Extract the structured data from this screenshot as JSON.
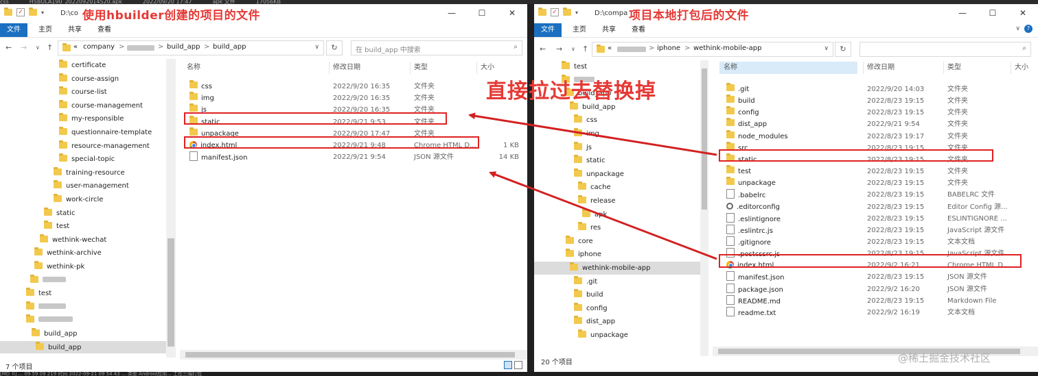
{
  "background": {
    "top_strip": [
      "css",
      "H5BULA190_2022092014520.apk",
      "2022/09/20 17:47",
      "apk 文件",
      "17056KB"
    ],
    "bottom_strip": "[MD_ll] ... 09 59 09 219  时间  2022-09-21 09 54 43  ...  类型  Android应用...  工在三端打包"
  },
  "left": {
    "title_path": "D:\\co",
    "title_note": "使用hbuilder创建的项目的文件",
    "window_buttons": [
      "—",
      "☐",
      "✕"
    ],
    "ribbon": [
      "文件",
      "主页",
      "共享",
      "查看"
    ],
    "address": [
      "«",
      "company",
      ">",
      "build_app",
      ">",
      "build_app"
    ],
    "search_placeholder": "在 build_app 中搜索",
    "tree": [
      {
        "label": "certificate"
      },
      {
        "label": "course-assign"
      },
      {
        "label": "course-list"
      },
      {
        "label": "course-management"
      },
      {
        "label": "my-responsible"
      },
      {
        "label": "questionnaire-template"
      },
      {
        "label": "resource-management"
      },
      {
        "label": "special-topic"
      },
      {
        "label": "training-resource"
      },
      {
        "label": "user-management"
      },
      {
        "label": "work-circle"
      },
      {
        "label": "static"
      },
      {
        "label": "test"
      },
      {
        "label": "wethink-wechat"
      },
      {
        "label": "wethink-archive"
      },
      {
        "label": "wethink-pk"
      },
      {
        "label": ""
      },
      {
        "label": "test"
      },
      {
        "label": ""
      },
      {
        "label": ""
      },
      {
        "label": "build_app"
      },
      {
        "label": "build_app"
      }
    ],
    "columns": [
      "名称",
      "修改日期",
      "类型",
      "大小"
    ],
    "files": [
      {
        "name": "css",
        "date": "2022/9/20 16:35",
        "type": "文件夹",
        "size": "",
        "icon": "folder"
      },
      {
        "name": "img",
        "date": "2022/9/20 16:35",
        "type": "文件夹",
        "size": "",
        "icon": "folder"
      },
      {
        "name": "js",
        "date": "2022/9/20 16:35",
        "type": "文件夹",
        "size": "",
        "icon": "folder"
      },
      {
        "name": "static",
        "date": "2022/9/21 9:53",
        "type": "文件夹",
        "size": "",
        "icon": "folder"
      },
      {
        "name": "unpackage",
        "date": "2022/9/20 17:47",
        "type": "文件夹",
        "size": "",
        "icon": "folder"
      },
      {
        "name": "index.html",
        "date": "2022/9/21 9:48",
        "type": "Chrome HTML D...",
        "size": "1 KB",
        "icon": "chrome"
      },
      {
        "name": "manifest.json",
        "date": "2022/9/21 9:54",
        "type": "JSON 源文件",
        "size": "14 KB",
        "icon": "file"
      }
    ],
    "status": "7 个项目"
  },
  "right": {
    "title_path": "D:\\compa",
    "title_note": "项目本地打包后的文件",
    "window_buttons": [
      "—",
      "☐",
      "✕"
    ],
    "ribbon": [
      "文件",
      "主页",
      "共享",
      "查看"
    ],
    "address": [
      "«",
      "iphone",
      ">",
      "wethink-mobile-app"
    ],
    "tree": [
      {
        "label": "test"
      },
      {
        "label": ""
      },
      {
        "label": "build_app"
      },
      {
        "label": "build_app"
      },
      {
        "label": "css"
      },
      {
        "label": "img"
      },
      {
        "label": "js"
      },
      {
        "label": "static"
      },
      {
        "label": "unpackage"
      },
      {
        "label": "cache"
      },
      {
        "label": "release"
      },
      {
        "label": "apk"
      },
      {
        "label": "res"
      },
      {
        "label": "core"
      },
      {
        "label": "iphone"
      },
      {
        "label": "wethink-mobile-app"
      },
      {
        "label": ".git"
      },
      {
        "label": "build"
      },
      {
        "label": "config"
      },
      {
        "label": "dist_app"
      },
      {
        "label": "unpackage"
      }
    ],
    "columns": [
      "名称",
      "修改日期",
      "类型",
      "大小"
    ],
    "files": [
      {
        "name": ".git",
        "date": "2022/9/20 14:03",
        "type": "文件夹",
        "icon": "folder"
      },
      {
        "name": "build",
        "date": "2022/8/23 19:15",
        "type": "文件夹",
        "icon": "folder"
      },
      {
        "name": "config",
        "date": "2022/8/23 19:15",
        "type": "文件夹",
        "icon": "folder"
      },
      {
        "name": "dist_app",
        "date": "2022/9/21 9:54",
        "type": "文件夹",
        "icon": "folder"
      },
      {
        "name": "node_modules",
        "date": "2022/8/23 19:17",
        "type": "文件夹",
        "icon": "folder"
      },
      {
        "name": "src",
        "date": "2022/8/23 19:15",
        "type": "文件夹",
        "icon": "folder"
      },
      {
        "name": "static",
        "date": "2022/8/23 19:15",
        "type": "文件夹",
        "icon": "folder"
      },
      {
        "name": "test",
        "date": "2022/8/23 19:15",
        "type": "文件夹",
        "icon": "folder"
      },
      {
        "name": "unpackage",
        "date": "2022/8/23 19:15",
        "type": "文件夹",
        "icon": "folder"
      },
      {
        "name": ".babelrc",
        "date": "2022/8/23 19:15",
        "type": "BABELRC 文件",
        "icon": "file"
      },
      {
        "name": ".editorconfig",
        "date": "2022/8/23 19:15",
        "type": "Editor Config 源...",
        "icon": "gear"
      },
      {
        "name": ".eslintignore",
        "date": "2022/8/23 19:15",
        "type": "ESLINTIGNORE ...",
        "icon": "file"
      },
      {
        "name": ".eslintrc.js",
        "date": "2022/8/23 19:15",
        "type": "JavaScript 源文件",
        "icon": "file"
      },
      {
        "name": ".gitignore",
        "date": "2022/8/23 19:15",
        "type": "文本文档",
        "icon": "file"
      },
      {
        "name": ".postcssrc.js",
        "date": "2022/8/23 19:15",
        "type": "JavaScript 源文件",
        "icon": "file"
      },
      {
        "name": "index.html",
        "date": "2022/9/2 16:21",
        "type": "Chrome HTML D...",
        "icon": "chrome"
      },
      {
        "name": "manifest.json",
        "date": "2022/8/23 19:15",
        "type": "JSON 源文件",
        "icon": "file"
      },
      {
        "name": "package.json",
        "date": "2022/9/2 16:20",
        "type": "JSON 源文件",
        "icon": "file"
      },
      {
        "name": "README.md",
        "date": "2022/8/23 19:15",
        "type": "Markdown File",
        "icon": "file"
      },
      {
        "name": "readme.txt",
        "date": "2022/9/2 16:19",
        "type": "文本文档",
        "icon": "file"
      }
    ],
    "status": "20 个项目"
  },
  "annotation": "直接拉过去替换掉",
  "watermark": "@稀土掘金技术社区",
  "colors": {
    "annotation": "#e53935",
    "arrow": "#d32020",
    "ribbon_file": "#1a6fc0"
  }
}
